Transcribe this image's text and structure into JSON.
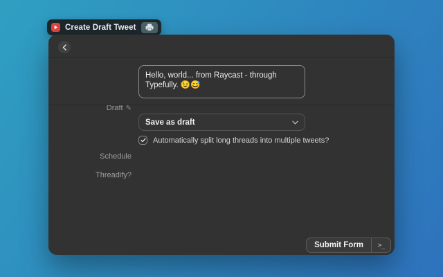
{
  "tab": {
    "title": "Create Draft Tweet",
    "app_icon": "typefully-icon",
    "badge_icon": "printer-icon"
  },
  "header": {
    "back_icon": "chevron-left-icon"
  },
  "form": {
    "draft": {
      "label": "Draft",
      "label_icon": "pencil-icon",
      "value": "Hello, world... from Raycast - through Typefully. 😉😅"
    },
    "schedule": {
      "label": "Schedule",
      "value": "Save as draft",
      "icon": "chevron-down-icon"
    },
    "threadify": {
      "label": "Threadify?",
      "checked": true,
      "checkbox_label": "Automatically split long threads into multiple tweets?"
    }
  },
  "footer": {
    "submit_label": "Submit Form",
    "shortcut_glyph": ">_"
  },
  "colors": {
    "background_start": "#2F9FC1",
    "background_end": "#2E72BD",
    "window_bg": "#323232",
    "accent_red": "#E0443C"
  }
}
